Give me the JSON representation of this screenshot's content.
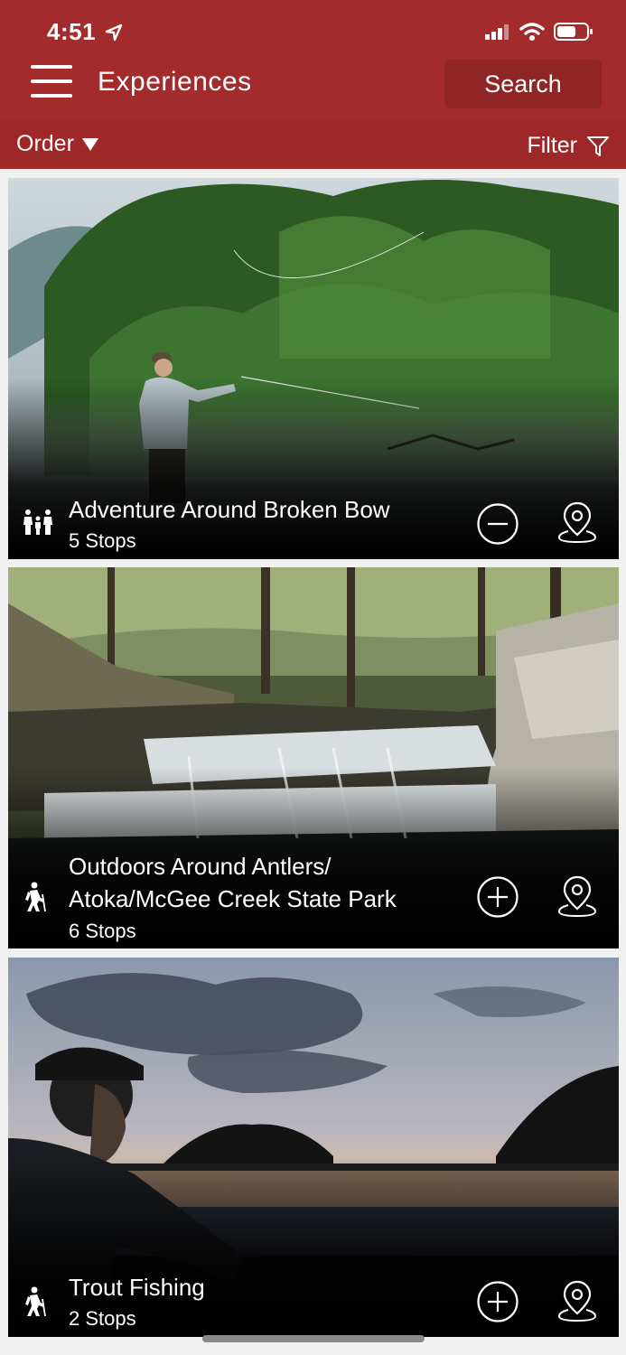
{
  "status_bar": {
    "time": "4:51"
  },
  "header": {
    "title": "Experiences",
    "search_label": "Search"
  },
  "toolbar": {
    "order_label": "Order",
    "filter_label": "Filter"
  },
  "experiences": [
    {
      "title_lines": [
        "Adventure Around Broken Bow"
      ],
      "stops": "5 Stops",
      "category_icon": "family-icon",
      "action": "remove"
    },
    {
      "title_lines": [
        "Outdoors Around Antlers/",
        "Atoka/McGee Creek State Park"
      ],
      "stops": "6 Stops",
      "category_icon": "hiker-icon",
      "action": "add"
    },
    {
      "title_lines": [
        "Trout Fishing"
      ],
      "stops": "2 Stops",
      "category_icon": "hiker-icon",
      "action": "add"
    }
  ],
  "colors": {
    "header": "#a32b2b",
    "subbar": "#9e2828",
    "search_button": "#8f2525"
  }
}
